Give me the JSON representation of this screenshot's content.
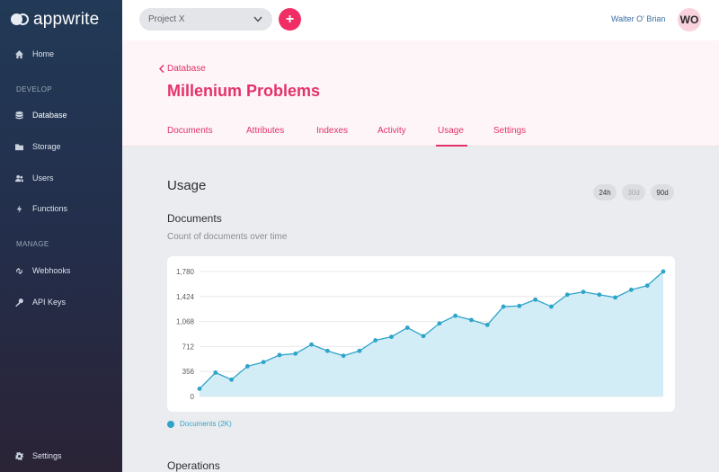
{
  "sidebar": {
    "logo": "appwrite",
    "items": [
      {
        "label": "Home",
        "icon": "home-icon"
      },
      {
        "label": "Database",
        "icon": "database-icon"
      },
      {
        "label": "Storage",
        "icon": "folder-icon"
      },
      {
        "label": "Users",
        "icon": "users-icon"
      },
      {
        "label": "Functions",
        "icon": "bolt-icon"
      },
      {
        "label": "Webhooks",
        "icon": "link-icon"
      },
      {
        "label": "API Keys",
        "icon": "key-icon"
      },
      {
        "label": "Settings",
        "icon": "gear-icon"
      }
    ],
    "sections": {
      "develop": "DEVELOP",
      "manage": "MANAGE"
    }
  },
  "header": {
    "project": "Project X",
    "add_label": "+",
    "user_name": "Walter O' Brian",
    "avatar_initials": "WO"
  },
  "banner": {
    "back_label": "Database",
    "title": "Millenium Problems",
    "tabs": [
      "Documents",
      "Attributes",
      "Indexes",
      "Activity",
      "Usage",
      "Settings"
    ],
    "active_tab": "Usage"
  },
  "content": {
    "title": "Usage",
    "ranges": [
      "24h",
      "30d",
      "90d"
    ],
    "documents_title": "Documents",
    "documents_subtitle": "Count of documents over time",
    "legend": "Documents (2K)",
    "operations_title": "Operations"
  },
  "colors": {
    "accent": "#f02e65",
    "chart_line": "#2fa4c9",
    "chart_fill": "#d3edf6"
  },
  "chart_data": {
    "type": "area",
    "ylim": [
      0,
      1780
    ],
    "yticks": [
      "0",
      "356",
      "712",
      "1,068",
      "1,424",
      "1,780"
    ],
    "series": [
      {
        "name": "Documents (2K)",
        "values": [
          110,
          340,
          240,
          430,
          490,
          590,
          610,
          740,
          650,
          580,
          650,
          800,
          850,
          980,
          860,
          1040,
          1150,
          1090,
          1020,
          1280,
          1290,
          1380,
          1280,
          1450,
          1490,
          1450,
          1410,
          1520,
          1580,
          1780
        ]
      }
    ]
  }
}
